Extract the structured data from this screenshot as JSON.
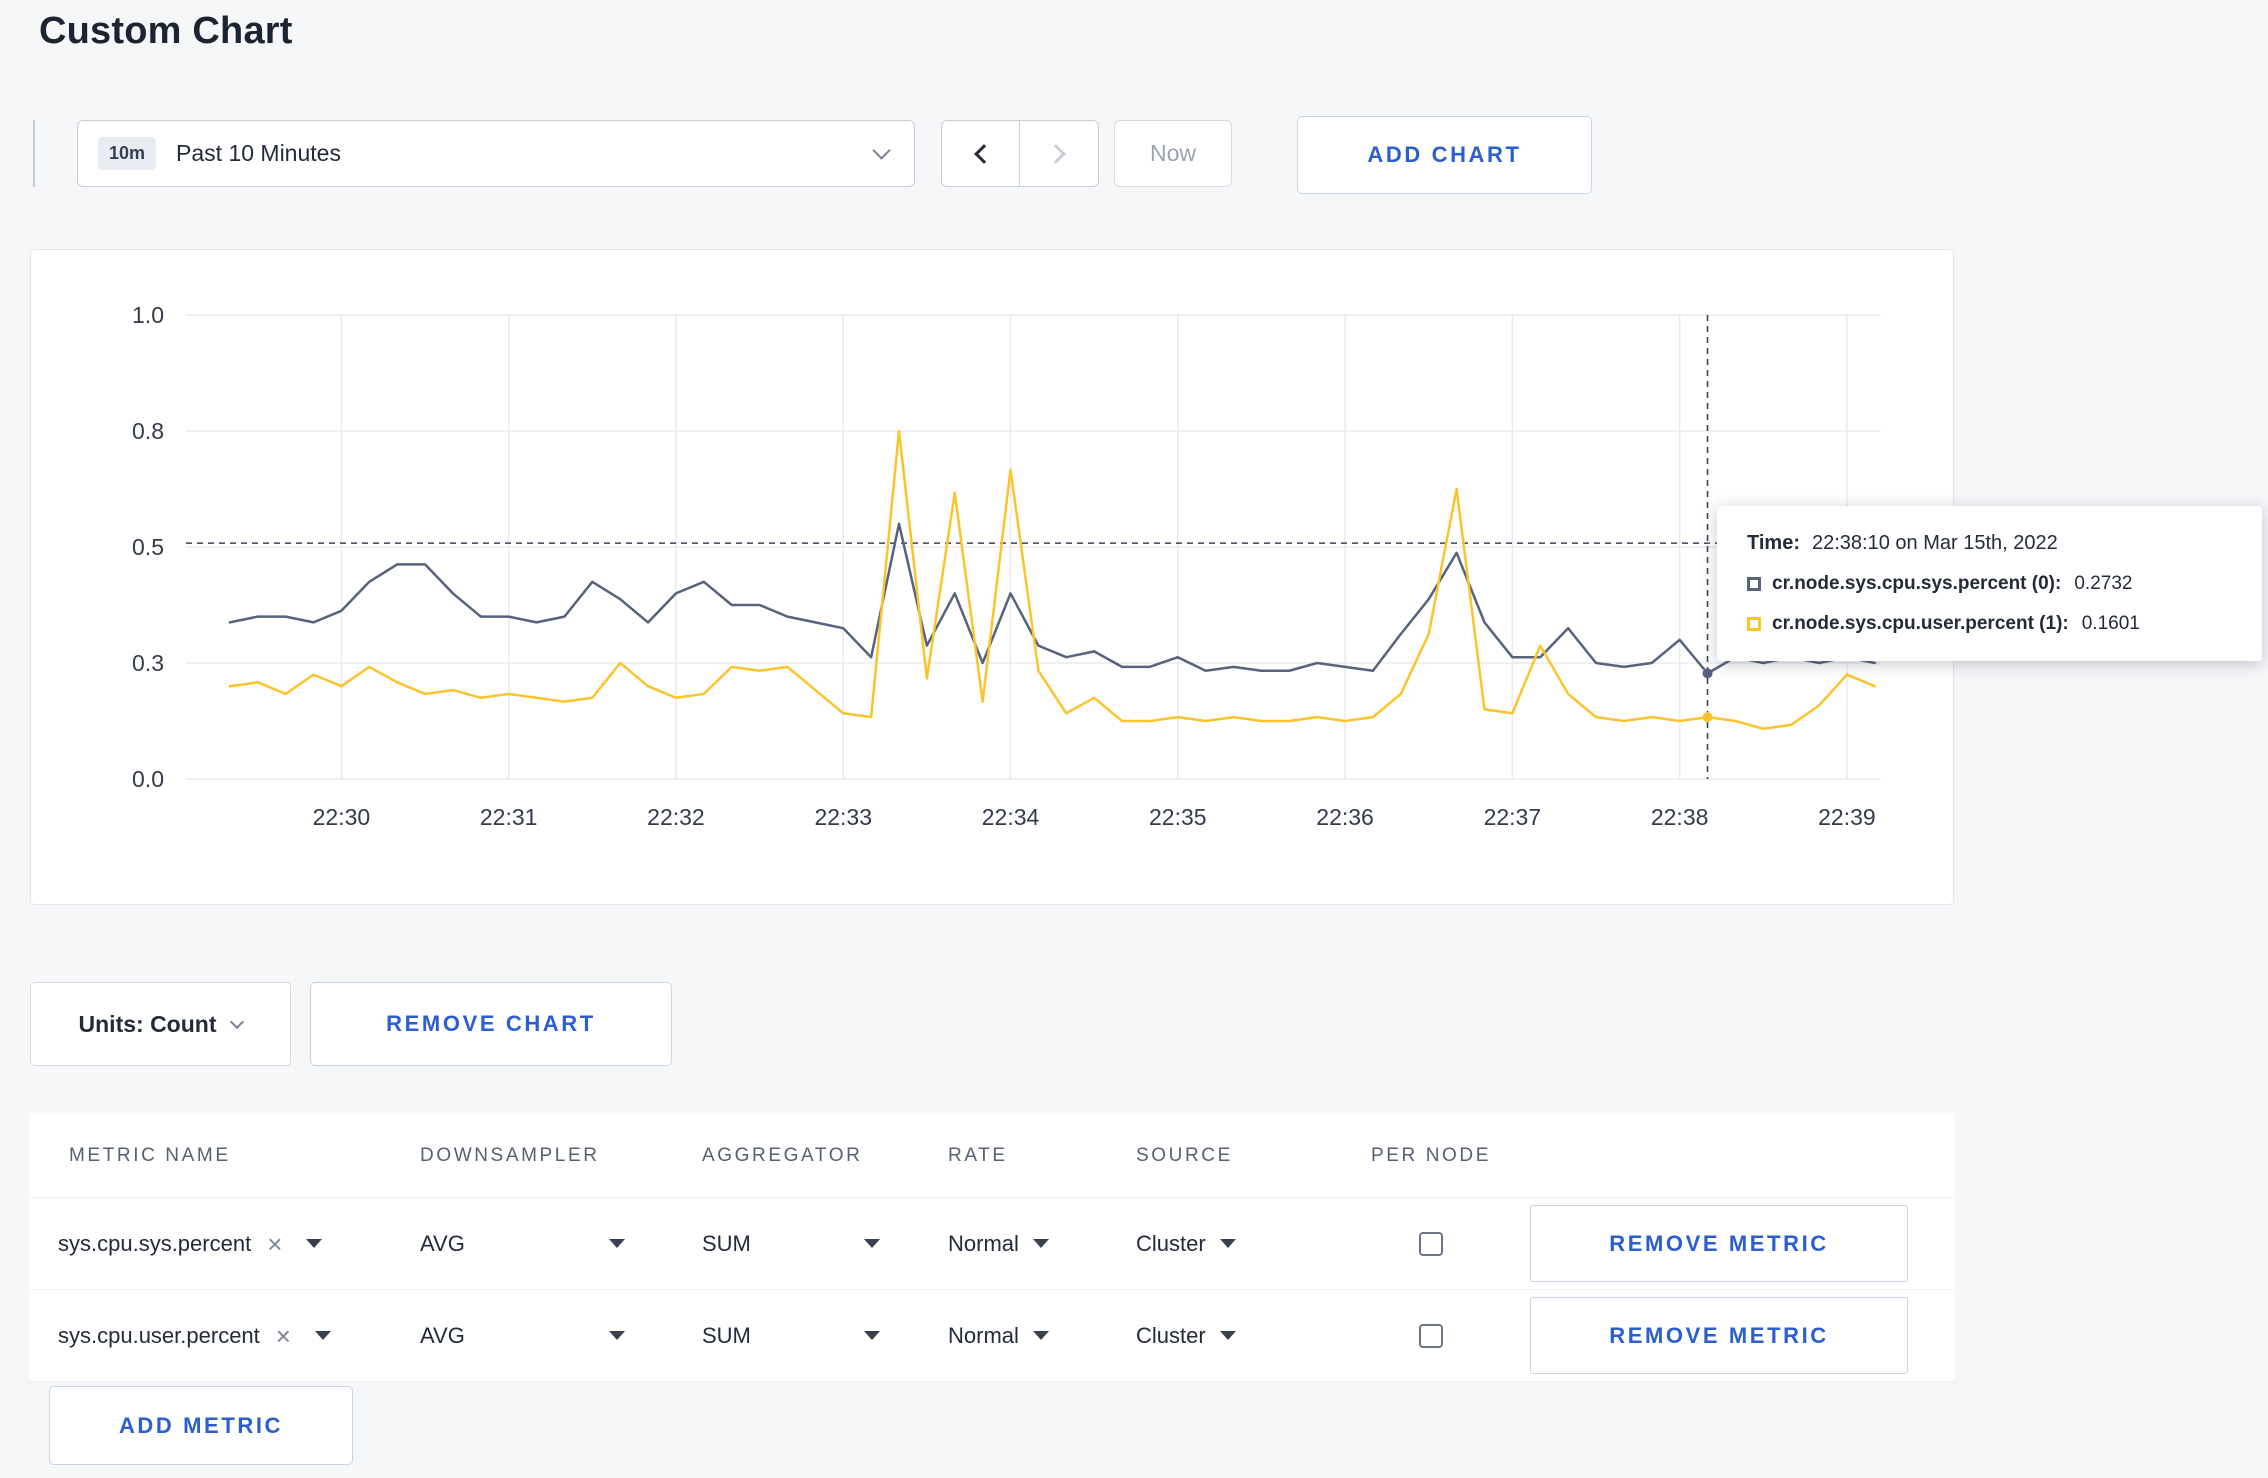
{
  "header": {
    "title": "Custom Chart"
  },
  "toolbar": {
    "time_range": {
      "badge": "10m",
      "label": "Past 10 Minutes"
    },
    "now_label": "Now",
    "add_chart_label": "ADD CHART"
  },
  "controls": {
    "units_label": "Units: Count",
    "remove_chart_label": "REMOVE CHART"
  },
  "tooltip": {
    "time_label": "Time:",
    "time_value": "22:38:10 on Mar 15th, 2022",
    "rows": [
      {
        "name": "cr.node.sys.cpu.sys.percent (0):",
        "value": "0.2732"
      },
      {
        "name": "cr.node.sys.cpu.user.percent (1):",
        "value": "0.1601"
      }
    ]
  },
  "table": {
    "headers": [
      "METRIC NAME",
      "DOWNSAMPLER",
      "AGGREGATOR",
      "RATE",
      "SOURCE",
      "PER NODE"
    ],
    "rows": [
      {
        "metric": "sys.cpu.sys.percent",
        "downsampler": "AVG",
        "aggregator": "SUM",
        "rate": "Normal",
        "source": "Cluster",
        "per_node": false,
        "remove_label": "REMOVE METRIC"
      },
      {
        "metric": "sys.cpu.user.percent",
        "downsampler": "AVG",
        "aggregator": "SUM",
        "rate": "Normal",
        "source": "Cluster",
        "per_node": false,
        "remove_label": "REMOVE METRIC"
      }
    ],
    "add_metric_label": "ADD METRIC"
  },
  "colors": {
    "accent_blue": "#2b5fd0",
    "series_sys": "#57627c",
    "series_user": "#fcc42c",
    "crosshair": "#3c4453",
    "gridline": "#e9ebef"
  },
  "chart_data": {
    "type": "line",
    "x_axis": {
      "start_time": "22:29:10",
      "interval_seconds": 10
    },
    "y_ticks": [
      0.0,
      0.3,
      0.5,
      0.8,
      1.0
    ],
    "x_ticks": [
      {
        "t": 50,
        "label": "22:30"
      },
      {
        "t": 110,
        "label": "22:31"
      },
      {
        "t": 170,
        "label": "22:32"
      },
      {
        "t": 230,
        "label": "22:33"
      },
      {
        "t": 290,
        "label": "22:34"
      },
      {
        "t": 350,
        "label": "22:35"
      },
      {
        "t": 410,
        "label": "22:36"
      },
      {
        "t": 470,
        "label": "22:37"
      },
      {
        "t": 530,
        "label": "22:38"
      },
      {
        "t": 590,
        "label": "22:39"
      }
    ],
    "t_start": 10,
    "t_step": 10,
    "series": [
      {
        "name": "cr.node.sys.cpu.sys.percent",
        "color": "#57627c",
        "values": [
          0.37,
          0.38,
          0.38,
          0.37,
          0.39,
          0.44,
          0.47,
          0.47,
          0.42,
          0.38,
          0.38,
          0.37,
          0.38,
          0.44,
          0.41,
          0.37,
          0.42,
          0.44,
          0.4,
          0.4,
          0.38,
          0.37,
          0.36,
          0.31,
          0.56,
          0.33,
          0.42,
          0.3,
          0.42,
          0.33,
          0.31,
          0.32,
          0.29,
          0.29,
          0.31,
          0.28,
          0.29,
          0.28,
          0.28,
          0.3,
          0.29,
          0.28,
          0.35,
          0.41,
          0.49,
          0.37,
          0.31,
          0.31,
          0.36,
          0.3,
          0.29,
          0.3,
          0.34,
          0.2732,
          0.31,
          0.3,
          0.31,
          0.3,
          0.31,
          0.3
        ]
      },
      {
        "name": "cr.node.sys.cpu.user.percent",
        "color": "#fcc42c",
        "values": [
          0.24,
          0.25,
          0.22,
          0.27,
          0.24,
          0.29,
          0.25,
          0.22,
          0.23,
          0.21,
          0.22,
          0.21,
          0.2,
          0.21,
          0.3,
          0.24,
          0.21,
          0.22,
          0.29,
          0.28,
          0.29,
          0.23,
          0.17,
          0.16,
          0.8,
          0.26,
          0.64,
          0.2,
          0.7,
          0.28,
          0.17,
          0.21,
          0.15,
          0.15,
          0.16,
          0.15,
          0.16,
          0.15,
          0.15,
          0.16,
          0.15,
          0.16,
          0.22,
          0.35,
          0.65,
          0.18,
          0.17,
          0.33,
          0.22,
          0.16,
          0.15,
          0.16,
          0.15,
          0.1601,
          0.15,
          0.13,
          0.14,
          0.19,
          0.27,
          0.24
        ]
      }
    ],
    "crosshair": {
      "t": 540,
      "time_label": "22:38:10",
      "hline_value": 0.51,
      "values": {
        "cr.node.sys.cpu.sys.percent": 0.2732,
        "cr.node.sys.cpu.user.percent": 0.1601
      }
    }
  }
}
